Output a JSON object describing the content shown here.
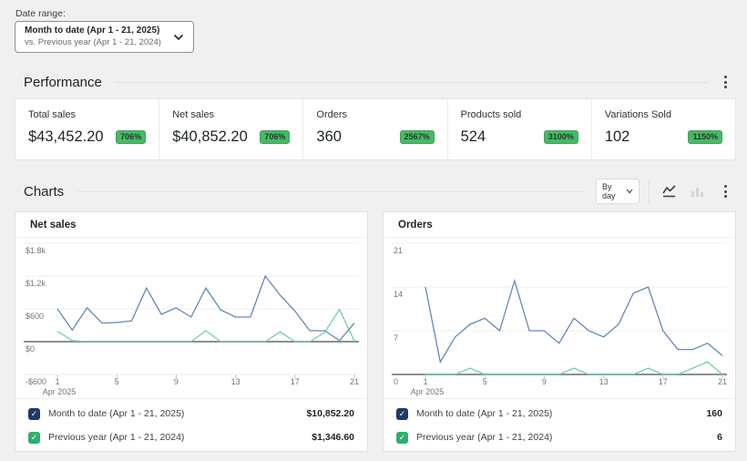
{
  "colors": {
    "badge_green": "#4ab866",
    "series_blue_line": "#6389b8",
    "series_green_line": "#76d09e",
    "legend_key_blue": "#20396b",
    "legend_key_green": "#2eb06b"
  },
  "icons": {
    "check_glyph": "✓",
    "date_range_chevron": "chevron-down-icon",
    "section_menu": "kebab-menu-icon",
    "chart_type_active": "line-chart-icon",
    "chart_type_inactive": "bar-chart-icon"
  },
  "date_range": {
    "label": "Date range:",
    "primary": "Month to date (Apr 1 - 21, 2025)",
    "secondary": "vs. Previous year (Apr 1 - 21, 2024)"
  },
  "performance": {
    "title": "Performance",
    "stats": [
      {
        "label": "Total sales",
        "value": "$43,452.20",
        "badge": "706%"
      },
      {
        "label": "Net sales",
        "value": "$40,852.20",
        "badge": "706%"
      },
      {
        "label": "Orders",
        "value": "360",
        "badge": "2567%"
      },
      {
        "label": "Products sold",
        "value": "524",
        "badge": "3100%"
      },
      {
        "label": "Variations Sold",
        "value": "102",
        "badge": "1150%"
      }
    ]
  },
  "charts_section": {
    "title": "Charts",
    "interval_select": "By day"
  },
  "chart_data": [
    {
      "type": "line",
      "title": "Net sales",
      "x": [
        1,
        2,
        3,
        4,
        5,
        6,
        7,
        8,
        9,
        10,
        11,
        12,
        13,
        14,
        15,
        16,
        17,
        18,
        19,
        20,
        21
      ],
      "xticks": [
        1,
        5,
        9,
        13,
        17,
        21
      ],
      "x_sublabel": "Apr 2025",
      "ylim": [
        -600,
        1800
      ],
      "grid": true,
      "legend_position": "bottom",
      "yticks": [
        {
          "label": "$1.8k",
          "value": 1800
        },
        {
          "label": "$1.2k",
          "value": 1200
        },
        {
          "label": "$600",
          "value": 600
        },
        {
          "label": "$0",
          "value": 0
        },
        {
          "label": "-$600",
          "value": -600
        }
      ],
      "series": [
        {
          "name": "Month to date (Apr 1 - 21, 2025)",
          "total": "$10,852.20",
          "color": "#6389b8",
          "key_color": "#20396b",
          "values": [
            600,
            210,
            620,
            340,
            350,
            380,
            980,
            500,
            620,
            450,
            980,
            580,
            450,
            450,
            1200,
            850,
            560,
            200,
            200,
            20,
            340
          ]
        },
        {
          "name": "Previous year (Apr 1 - 21, 2024)",
          "total": "$1,346.60",
          "color": "#76d09e",
          "key_color": "#2eb06b",
          "values": [
            190,
            20,
            0,
            0,
            0,
            0,
            0,
            0,
            0,
            0,
            200,
            0,
            0,
            0,
            0,
            180,
            0,
            0,
            170,
            590,
            10
          ]
        }
      ]
    },
    {
      "type": "line",
      "title": "Orders",
      "x": [
        1,
        2,
        3,
        4,
        5,
        6,
        7,
        8,
        9,
        10,
        11,
        12,
        13,
        14,
        15,
        16,
        17,
        18,
        19,
        20,
        21
      ],
      "xticks": [
        1,
        5,
        9,
        13,
        17,
        21
      ],
      "x_sublabel": "Apr 2025",
      "ylim": [
        0,
        21
      ],
      "grid": true,
      "legend_position": "bottom",
      "yticks": [
        {
          "label": "21",
          "value": 21
        },
        {
          "label": "14",
          "value": 14
        },
        {
          "label": "7",
          "value": 7
        },
        {
          "label": "0",
          "value": 0
        }
      ],
      "series": [
        {
          "name": "Month to date (Apr 1 - 21, 2025)",
          "total": "160",
          "color": "#6389b8",
          "key_color": "#20396b",
          "values": [
            14,
            2,
            6,
            8,
            9,
            7,
            15,
            7,
            7,
            5,
            9,
            7,
            6,
            8,
            13,
            14,
            7,
            4,
            4,
            5,
            3
          ]
        },
        {
          "name": "Previous year (Apr 1 - 21, 2024)",
          "total": "6",
          "color": "#76d09e",
          "key_color": "#2eb06b",
          "values": [
            0,
            0,
            0,
            1,
            0,
            0,
            0,
            0,
            0,
            0,
            1,
            0,
            0,
            0,
            0,
            1,
            0,
            0,
            1,
            2,
            0
          ]
        }
      ]
    }
  ]
}
